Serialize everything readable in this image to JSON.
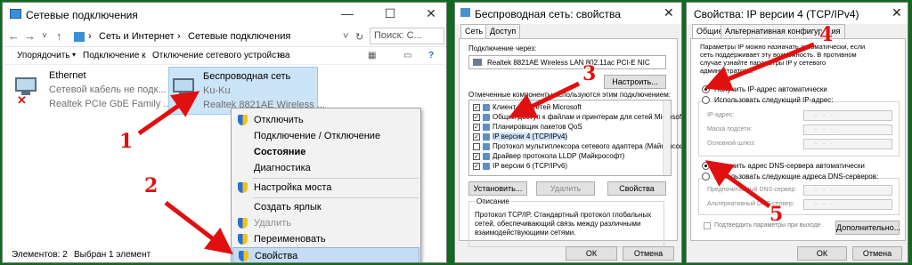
{
  "p1": {
    "title": "Сетевые подключения",
    "crumbs": [
      "Сеть и Интернет",
      "Сетевые подключения"
    ],
    "search_placeholder": "Поиск: С...",
    "cmd": [
      "Упорядочить",
      "Подключение к",
      "Отключение сетевого устройства",
      "»"
    ],
    "ethernet": {
      "name": "Ethernet",
      "status": "Сетевой кабель не подк...",
      "adapter": "Realtek PCIe GbE Family ..."
    },
    "wifi": {
      "name": "Беспроводная сеть",
      "status": "Ku-Ku",
      "adapter": "Realtek 8821AE Wireless ..."
    },
    "menu": [
      "Отключить",
      "Подключение / Отключение",
      "Состояние",
      "Диагностика",
      "Настройка моста",
      "Создать ярлык",
      "Удалить",
      "Переименовать",
      "Свойства"
    ],
    "status_items": "Элементов: 2",
    "status_selected": "Выбран 1 элемент"
  },
  "p2": {
    "title": "Беспроводная сеть: свойства",
    "tabs": [
      "Сеть",
      "Доступ"
    ],
    "connect_using": "Подключение через:",
    "adapter": "Realtek 8821AE Wireless LAN 802.11ac PCI-E NIC",
    "configure": "Настроить...",
    "components_label": "Отмеченные компоненты используются этим подключением:",
    "components": [
      {
        "text": "Клиент для сетей Microsoft",
        "checked": "✓"
      },
      {
        "text": "Общий доступ к файлам и принтерам для сетей Microsoft",
        "checked": "✓"
      },
      {
        "text": "Планировщик пакетов QoS",
        "checked": "✓"
      },
      {
        "text": "IP версии 4 (TCP/IPv4)",
        "checked": "✓"
      },
      {
        "text": "Протокол мультиплексора сетевого адаптера (Майкрософт)",
        "checked": ""
      },
      {
        "text": "Драйвер протокола LLDP (Майкрософт)",
        "checked": "✓"
      },
      {
        "text": "IP версии 6 (TCP/IPv6)",
        "checked": "✓"
      }
    ],
    "install": "Установить...",
    "remove": "Удалить",
    "properties": "Свойства",
    "desc_header": "Описание",
    "description": "Протокол TCP/IP. Стандартный протокол глобальных сетей, обеспечивающий связь между различными взаимодействующими сетями.",
    "ok": "ОК",
    "cancel": "Отмена"
  },
  "p3": {
    "title": "Свойства: IP версии 4 (TCP/IPv4)",
    "tabs": [
      "Общие",
      "Альтернативная конфигурация"
    ],
    "intro": "Параметры IP можно назначать автоматически, если сеть поддерживает эту возможность. В противном случае узнайте параметры IP у сетевого администратора.",
    "auto_ip": "Получить IP-адрес автоматически",
    "manual_ip": "Использовать следующий IP-адрес:",
    "ip_label": "IP-адрес:",
    "mask_label": "Маска подсети:",
    "gateway_label": "Основной шлюз:",
    "auto_dns": "Получить адрес DNS-сервера автоматически",
    "manual_dns": "Использовать следующие адреса DNS-серверов:",
    "pref_dns": "Предпочитаемый DNS-сервер:",
    "alt_dns": "Альтернативный DNS-сервер:",
    "validate": "Подтвердить параметры при выходе",
    "advanced": "Дополнительно...",
    "ok": "ОК",
    "cancel": "Отмена"
  },
  "annotations": [
    "1",
    "2",
    "3",
    "4",
    "5"
  ],
  "colors": {
    "background": "#0f6a1f",
    "arrow": "#e01010",
    "highlight": "#c5dcf2"
  }
}
